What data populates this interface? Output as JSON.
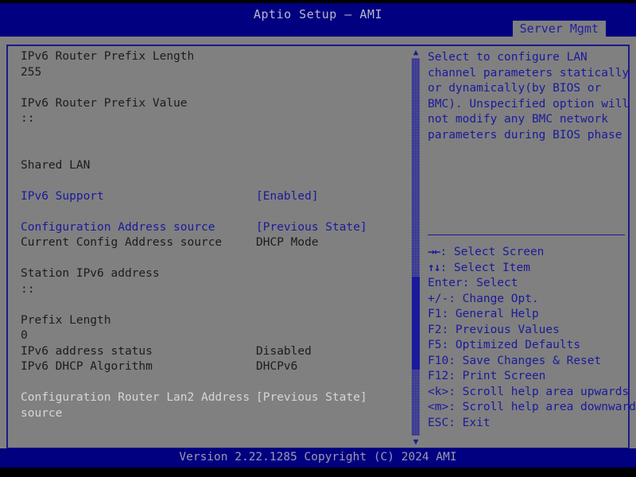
{
  "header": {
    "title": "Aptio Setup – AMI",
    "active_tab": "Server Mgmt"
  },
  "main": {
    "rows": [
      {
        "label": "IPv6 Router Prefix Length",
        "value": "",
        "label_style": "dark",
        "value_style": "dark"
      },
      {
        "label": "255",
        "value": "",
        "label_style": "dark",
        "value_style": "dark"
      },
      {
        "label": "",
        "value": "",
        "label_style": "dark",
        "value_style": "dark"
      },
      {
        "label": "IPv6 Router Prefix Value",
        "value": "",
        "label_style": "dark",
        "value_style": "dark"
      },
      {
        "label": "::",
        "value": "",
        "label_style": "dark",
        "value_style": "dark"
      },
      {
        "label": "",
        "value": "",
        "label_style": "dark",
        "value_style": "dark"
      },
      {
        "label": "",
        "value": "",
        "label_style": "dark",
        "value_style": "dark"
      },
      {
        "label": "Shared LAN",
        "value": "",
        "label_style": "dark",
        "value_style": "dark"
      },
      {
        "label": "",
        "value": "",
        "label_style": "dark",
        "value_style": "dark"
      },
      {
        "label": "IPv6 Support",
        "value": "[Enabled]",
        "label_style": "blue",
        "value_style": "blue"
      },
      {
        "label": "",
        "value": "",
        "label_style": "dark",
        "value_style": "dark"
      },
      {
        "label": "Configuration Address source",
        "value": "[Previous State]",
        "label_style": "blue",
        "value_style": "blue"
      },
      {
        "label": "Current Config Address source",
        "value": "DHCP Mode",
        "label_style": "dark",
        "value_style": "dark"
      },
      {
        "label": "",
        "value": "",
        "label_style": "dark",
        "value_style": "dark"
      },
      {
        "label": "Station IPv6 address",
        "value": "",
        "label_style": "dark",
        "value_style": "dark"
      },
      {
        "label": "::",
        "value": "",
        "label_style": "dark",
        "value_style": "dark"
      },
      {
        "label": "",
        "value": "",
        "label_style": "dark",
        "value_style": "dark"
      },
      {
        "label": "Prefix Length",
        "value": "",
        "label_style": "dark",
        "value_style": "dark"
      },
      {
        "label": "0",
        "value": "",
        "label_style": "dark",
        "value_style": "dark"
      },
      {
        "label": "IPv6 address status",
        "value": "Disabled",
        "label_style": "dark",
        "value_style": "dark"
      },
      {
        "label": "IPv6 DHCP Algorithm",
        "value": "DHCPv6",
        "label_style": "dark",
        "value_style": "dark"
      },
      {
        "label": "",
        "value": "",
        "label_style": "dark",
        "value_style": "dark"
      },
      {
        "label": "Configuration Router Lan2 Address",
        "value": "[Previous State]",
        "label_style": "gray",
        "value_style": "gray"
      },
      {
        "label": "source",
        "value": "",
        "label_style": "gray",
        "value_style": "gray"
      }
    ],
    "scrollbar": {
      "up_arrow": "▲",
      "down_arrow": "▼"
    }
  },
  "help": {
    "lines": [
      "Select to configure LAN",
      "channel parameters statically",
      "or dynamically(by BIOS or",
      "BMC). Unspecified option will",
      "not modify any BMC network",
      "parameters during BIOS phase"
    ],
    "keys": [
      {
        "glyph": "→←",
        "text": ": Select Screen"
      },
      {
        "glyph": "↑↓",
        "text": ": Select Item"
      },
      {
        "glyph": "",
        "text": "Enter: Select"
      },
      {
        "glyph": "",
        "text": "+/-: Change Opt."
      },
      {
        "glyph": "",
        "text": "F1: General Help"
      },
      {
        "glyph": "",
        "text": "F2: Previous Values"
      },
      {
        "glyph": "",
        "text": "F5: Optimized Defaults"
      },
      {
        "glyph": "",
        "text": "F10: Save Changes & Reset"
      },
      {
        "glyph": "",
        "text": "F12: Print Screen"
      },
      {
        "glyph": "",
        "text": "<k>: Scroll help area upwards"
      },
      {
        "glyph": "",
        "text": "<m>: Scroll help area downwards"
      },
      {
        "glyph": "",
        "text": "ESC: Exit"
      }
    ]
  },
  "footer": {
    "version_text": "Version 2.22.1285 Copyright (C) 2024 AMI"
  },
  "colors": {
    "title_bar": "#000080",
    "panel_bg": "#808080",
    "border": "#1a1a8c",
    "accent_blue": "#1a1a9c",
    "static_text": "#1c1c1c",
    "disabled_text": "#d6d6d6"
  }
}
